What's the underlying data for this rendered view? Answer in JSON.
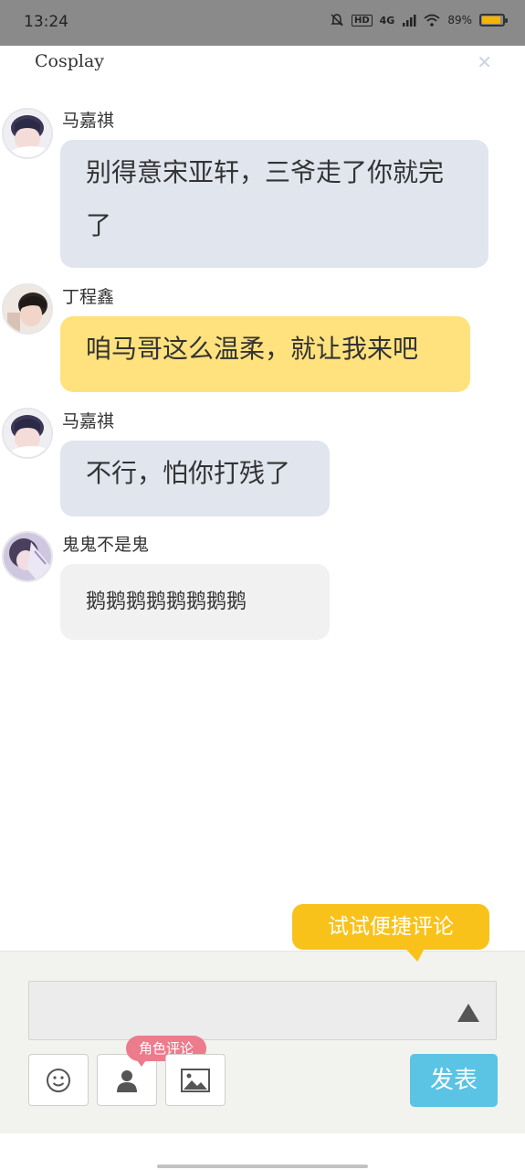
{
  "status_bar": {
    "time": "13:24",
    "network": "4G",
    "hd": "HD",
    "battery": "89%",
    "battery_level": 0.89
  },
  "header": {
    "title": "Cosplay",
    "close_icon": "close-icon"
  },
  "messages": [
    {
      "user": "马嘉祺",
      "text": "别得意宋亚轩，三爷走了你就完了",
      "color": "#e0e5ee"
    },
    {
      "user": "丁程鑫",
      "text": "咱马哥这么温柔，就让我来吧",
      "color": "#ffe27d"
    },
    {
      "user": "马嘉祺",
      "text": "不行，怕你打残了",
      "color": "#e0e5ee"
    },
    {
      "user": "鬼鬼不是鬼",
      "text": "鹅鹅鹅鹅鹅鹅鹅鹅",
      "color": "#f1f1f1"
    }
  ],
  "composer": {
    "tip": "试试便捷评论",
    "role_badge": "角色评论",
    "send_label": "发表",
    "accent": "#5bc3e4",
    "tip_color": "#f9c21b",
    "badge_color": "#ec7b8c"
  }
}
